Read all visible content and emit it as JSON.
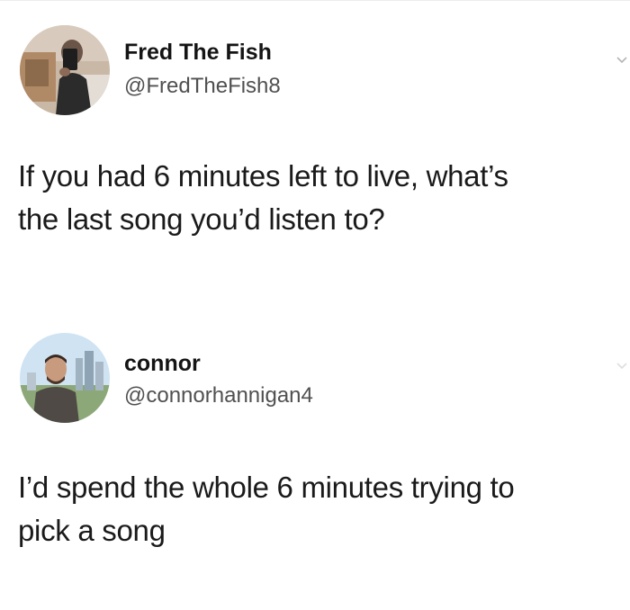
{
  "tweets": [
    {
      "display_name": "Fred The Fish",
      "handle": "@FredTheFish8",
      "avatar_icon": "profile-photo-mirror-selfie",
      "text_lines": [
        "If you had 6 minutes left to live, what’s",
        "the last song you’d listen to?"
      ]
    },
    {
      "display_name": "connor",
      "handle": "@connorhannigan4",
      "avatar_icon": "profile-photo-city-skyline",
      "text_lines": [
        "I’d spend the whole 6 minutes trying to",
        "pick a song"
      ]
    }
  ],
  "colors": {
    "text": "#1a1a1a",
    "handle": "#505050",
    "background": "#ffffff"
  }
}
